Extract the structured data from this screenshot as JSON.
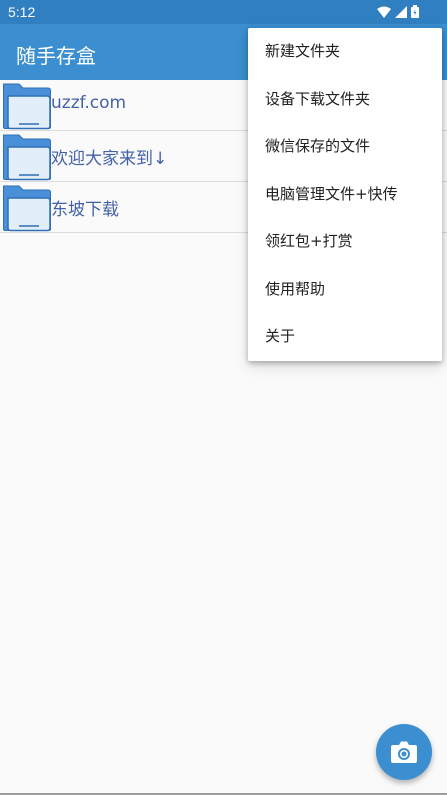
{
  "status_bar": {
    "time": "5:12"
  },
  "app_bar": {
    "title": "随手存盒"
  },
  "files": [
    {
      "name": "uzzf.com"
    },
    {
      "name": "欢迎大家来到↓"
    },
    {
      "name": "东坡下载"
    }
  ],
  "menu": {
    "items": [
      {
        "label": "新建文件夹"
      },
      {
        "label": "设备下载文件夹"
      },
      {
        "label": "微信保存的文件"
      },
      {
        "label": "电脑管理文件+快传"
      },
      {
        "label": "领红包+打赏"
      },
      {
        "label": "使用帮助"
      },
      {
        "label": "关于"
      }
    ]
  },
  "fab": {
    "icon": "camera-icon"
  },
  "colors": {
    "primary": "#3b8fd0",
    "status_bar": "#2f7fc1",
    "file_text": "#4461a8"
  }
}
